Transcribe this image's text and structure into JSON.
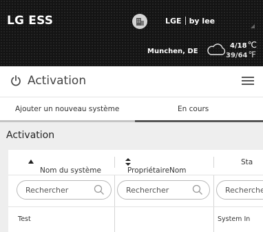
{
  "header": {
    "app_title": "LG ESS",
    "company": "LGE",
    "user": "by lee",
    "location": "Munchen, DE",
    "temp_c": "4/18",
    "temp_c_unit": "℃",
    "temp_f": "39/64",
    "temp_f_unit": "℉",
    "icons": {
      "site": "building-icon",
      "weather": "cloud-icon"
    }
  },
  "page": {
    "title": "Activation",
    "icons": {
      "title": "power-icon",
      "menu": "hamburger-menu-icon"
    }
  },
  "tabs": [
    {
      "label": "Ajouter un nouveau système",
      "active": false
    },
    {
      "label": "En cours",
      "active": true
    }
  ],
  "section": {
    "title": "Activation"
  },
  "table": {
    "columns": [
      {
        "label": "Nom du système",
        "sort": "ascending"
      },
      {
        "label": "PropriétaireNom",
        "sort": "both"
      },
      {
        "label": "Sta"
      }
    ],
    "search_placeholder": "Rechercher",
    "rows": [
      {
        "name": "Test",
        "owner": "",
        "status": "System In"
      }
    ]
  },
  "colors": {
    "header_bg": "#141414",
    "content_bg": "#eeeeee",
    "active_tab_border": "#555555",
    "inactive_tab_border": "#c4c4c4"
  }
}
